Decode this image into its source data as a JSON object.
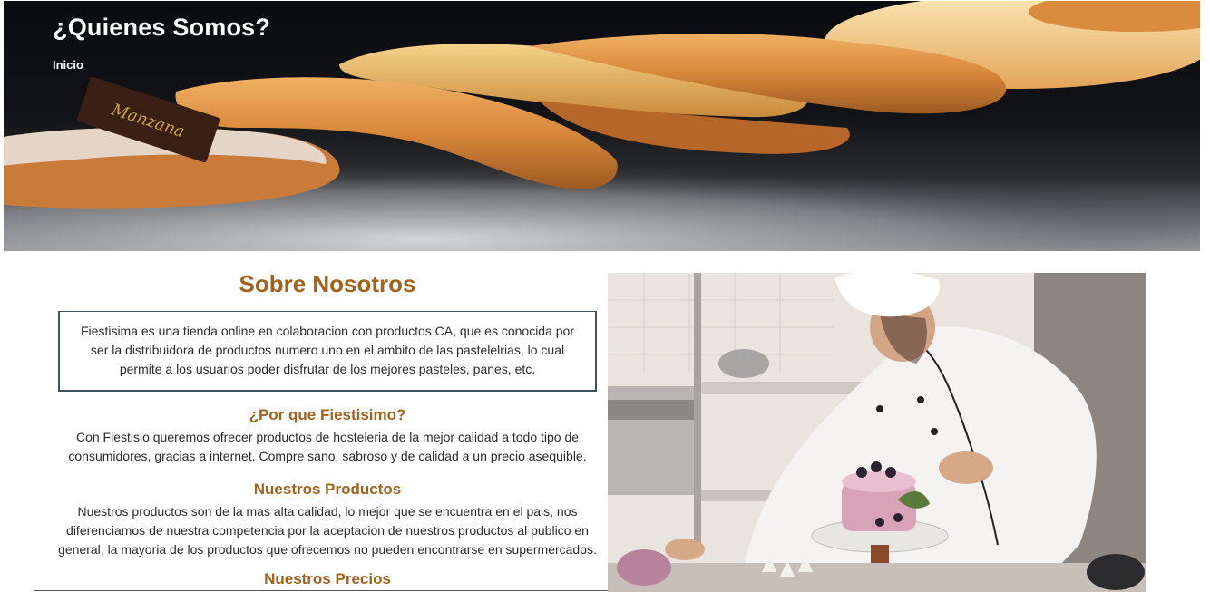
{
  "hero": {
    "title": "¿Quienes Somos?",
    "breadcrumb": "Inicio",
    "image_label_text": "Manzana"
  },
  "about": {
    "heading": "Sobre Nosotros",
    "intro": "Fiestisima es una tienda online en colaboracion con productos CA, que es conocida por ser la distribuidora de productos numero uno en el ambito de las pastelelrias, lo cual permite a los usuarios poder disfrutar de los mejores pasteles, panes, etc.",
    "why_heading": "¿Por que Fiestisimo?",
    "why_text": "Con Fiestisio queremos ofrecer productos de hosteleria de la mejor calidad a todo tipo de consumidores, gracias a internet. Compre sano, sabroso y de calidad a un precio asequible.",
    "products_heading": "Nuestros Productos",
    "products_text": "Nuestros productos son de la mas alta calidad, lo mejor que se encuentra en el pais, nos diferenciamos de nuestra competencia por la aceptacion de nuestros productos al publico en general, la mayoria de los productos que ofrecemos no pueden encontrarse en supermercados.",
    "next_heading_partial": "Nuestros Precios"
  },
  "colors": {
    "heading_brown": "#a0621d",
    "box_border": "#3e5560",
    "body_text": "#2b2b2b"
  },
  "icons": {
    "hero_image": "pastries-photo",
    "side_image": "pastry-chef-photo"
  }
}
